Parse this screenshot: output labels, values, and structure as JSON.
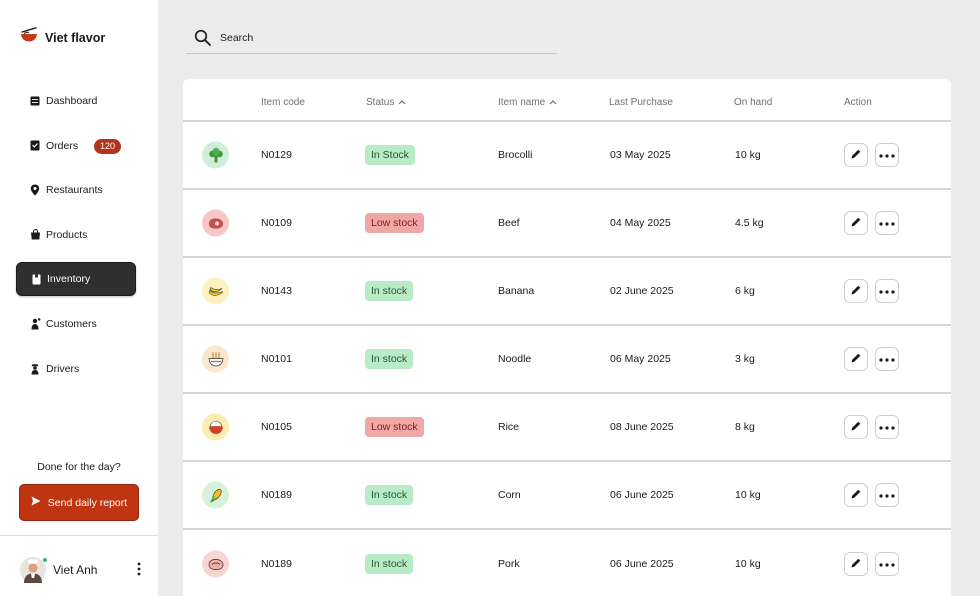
{
  "brand": {
    "name": "Viet flavor"
  },
  "sidebar": {
    "items": [
      {
        "label": "Dashboard",
        "icon": "dashboard-icon"
      },
      {
        "label": "Orders",
        "icon": "orders-icon",
        "badge": "120"
      },
      {
        "label": "Restaurants",
        "icon": "location-pin-icon"
      },
      {
        "label": "Products",
        "icon": "shopping-bag-icon"
      },
      {
        "label": "Inventory",
        "icon": "inventory-icon",
        "active": true
      },
      {
        "label": "Customers",
        "icon": "customer-icon"
      },
      {
        "label": "Drivers",
        "icon": "driver-icon"
      }
    ],
    "done_text": "Done for the day?",
    "report_button": "Send daily report",
    "user_name": "Viet Anh"
  },
  "search": {
    "placeholder": "Search"
  },
  "table": {
    "headers": {
      "item_code": "Item code",
      "status": "Status",
      "item_name": "Item name",
      "last_purchase": "Last Purchase",
      "on_hand": "On hand",
      "action": "Action"
    },
    "rows": [
      {
        "icon": "broccoli-icon",
        "code": "N0129",
        "status": "In Stock",
        "status_type": "in",
        "name": "Brocolli",
        "last_purchase": "03 May 2025",
        "on_hand": "10 kg"
      },
      {
        "icon": "beef-icon",
        "code": "N0109",
        "status": "Low stock",
        "status_type": "low",
        "name": "Beef",
        "last_purchase": "04 May 2025",
        "on_hand": "4.5 kg"
      },
      {
        "icon": "banana-icon",
        "code": "N0143",
        "status": "In stock",
        "status_type": "in",
        "name": "Banana",
        "last_purchase": "02 June 2025",
        "on_hand": "6 kg"
      },
      {
        "icon": "noodle-icon",
        "code": "N0101",
        "status": "In stock",
        "status_type": "in",
        "name": "Noodle",
        "last_purchase": "06 May 2025",
        "on_hand": "3 kg"
      },
      {
        "icon": "rice-icon",
        "code": "N0105",
        "status": "Low stock",
        "status_type": "low",
        "name": "Rice",
        "last_purchase": "08 June 2025",
        "on_hand": "8 kg"
      },
      {
        "icon": "corn-icon",
        "code": "N0189",
        "status": "In stock",
        "status_type": "in",
        "name": "Corn",
        "last_purchase": "06 June 2025",
        "on_hand": "10 kg"
      },
      {
        "icon": "pork-icon",
        "code": "N0189",
        "status": "In stock",
        "status_type": "in",
        "name": "Pork",
        "last_purchase": "06 June 2025",
        "on_hand": "10 kg"
      }
    ]
  },
  "colors": {
    "accent": "#bf3411",
    "badge": "#b5331b",
    "in_stock_bg": "#b9ebc8",
    "low_stock_bg": "#f2a7a7",
    "active_nav": "#2f2f2f"
  }
}
